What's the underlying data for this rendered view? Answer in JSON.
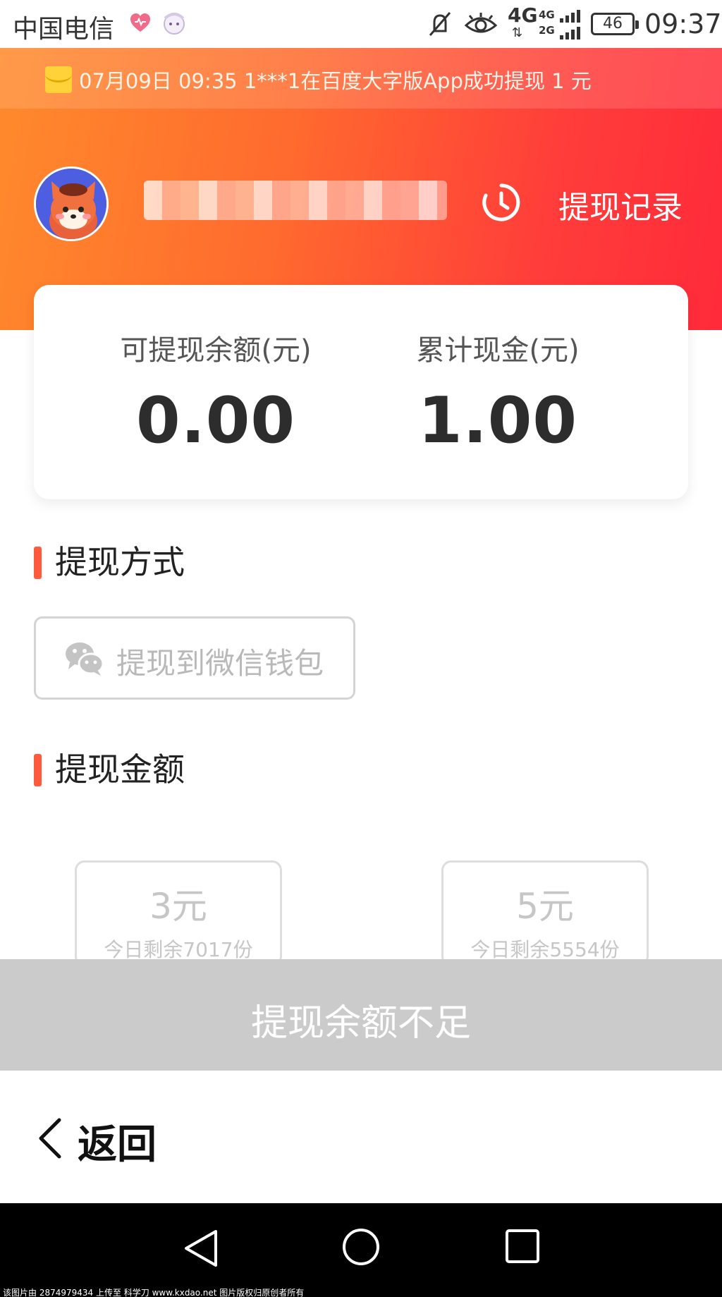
{
  "status_bar": {
    "carrier": "中国电信",
    "network": "4G",
    "network_secondary": "4G 2G",
    "battery": "46",
    "time": "09:37",
    "icons": [
      "heart-icon",
      "avatar-sticker-icon",
      "mute-icon",
      "eye-icon",
      "signal-icon",
      "battery-icon"
    ]
  },
  "ticker": {
    "icon": "red-envelope-icon",
    "text": "07月09日 09:35 1***1在百度大字版App成功提现 1 元"
  },
  "header": {
    "avatar_icon": "fox-avatar-icon",
    "history_icon": "clock-icon",
    "history_label": "提现记录"
  },
  "balance": {
    "available_label": "可提现余额(元)",
    "available_value": "0.00",
    "total_label": "累计现金(元)",
    "total_value": "1.00"
  },
  "method_section": {
    "title": "提现方式",
    "option_icon": "wechat-icon",
    "option_label": "提现到微信钱包"
  },
  "amount_section": {
    "title": "提现金额",
    "options": [
      {
        "value": "3元",
        "remaining": "今日剩余7017份"
      },
      {
        "value": "5元",
        "remaining": "今日剩余5554份"
      }
    ]
  },
  "submit": {
    "label": "提现余额不足"
  },
  "back": {
    "label": "返回"
  },
  "nav_bar": {
    "icons": [
      "nav-back-icon",
      "nav-home-icon",
      "nav-recent-icon"
    ]
  },
  "watermark": "该图片由 2874979434 上传至 科学刀 www.kxdao.net 图片版权归原创者所有",
  "colors": {
    "gradient_start": "#ff8a2c",
    "gradient_end": "#ff2a3a",
    "accent_bar": "#ff5a3c",
    "disabled_button": "#cbcbcb"
  }
}
